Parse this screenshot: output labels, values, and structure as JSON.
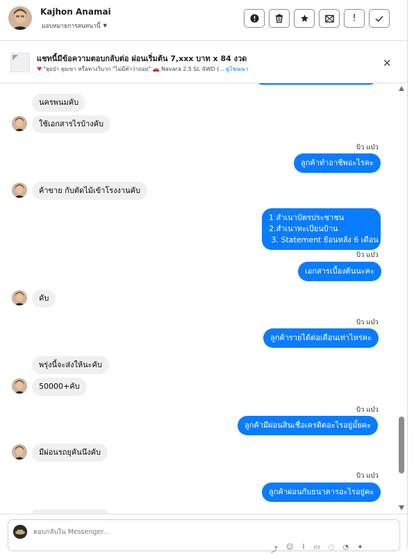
{
  "header": {
    "contact_name": "Kajhon Anamai",
    "assign_label": "มอบหมายการสนทนานี้",
    "actions": [
      {
        "name": "spam-button",
        "icon": "exclamation-circle-icon",
        "glyph": "!"
      },
      {
        "name": "delete-button",
        "icon": "trash-icon",
        "glyph": "🗑"
      },
      {
        "name": "star-button",
        "icon": "star-icon",
        "glyph": "★"
      },
      {
        "name": "mark-unread-button",
        "icon": "envelope-icon",
        "glyph": "✉"
      },
      {
        "name": "follow-up-button",
        "icon": "exclamation-icon",
        "glyph": "!"
      },
      {
        "name": "done-button",
        "icon": "check-icon",
        "glyph": "✓"
      }
    ]
  },
  "ad": {
    "title": "แชทนี้มีข้อความตอบกลับต่อ ผ่อนเริ่มต้น 7,xxx บาท x 84 งวด",
    "subtitle": "\"ลุยป่า ลุยเขา หรือทางวิบาก \"ไม่มีคำว่าถอย\" 🚗 Navara 2.5 SL 4WD (...",
    "link": "ดูโฆษณา"
  },
  "messages": {
    "m1": "นครพนมคับ",
    "m2": "ใช้เอกสารไรบ้างคับ",
    "m3_sender": "บิว แบ๋ว",
    "m3": "ลูกค้าทำอาชีพอะไรคะ",
    "m4": "ค้าขาย กับตัดไม้เข้าโรงงานคับ",
    "m5_lines": [
      "1 สำเนาบัตรประชาชน",
      "2.สำเนาทะเบียนบ้าน",
      " 3. Statement ย้อนหลัง 6 เดือน"
    ],
    "m6_sender": "บิว แบ๋ว",
    "m6": "เอกสารเบื้องต้นนะคะ",
    "m7": "คับ",
    "m8_sender": "บิว แบ๋ว",
    "m8": "ลูกค้ารายได้ต่อเดือนเท่าไหร่คะ",
    "m9": "พรุ่งนี้จะส่งให้นะคับ",
    "m10": "50000+คับ",
    "m11_sender": "บิว แบ๋ว",
    "m11": "ลูกค้ามีผ่อนสินเชื่อเครดิตอะไรอยู่มั้ยคะ",
    "m12": "มีผ่อนรถยุคันนึงคับ",
    "m13_sender": "บิว แบ๋ว",
    "m13": "ลูกค้าผ่อนกับธนาคารอะไรอยู่คะ"
  },
  "composer": {
    "placeholder": "ตอบกลับใน Messenger..."
  },
  "colors": {
    "outgoing": "#0a7cff",
    "incoming": "#f0f0f0"
  }
}
